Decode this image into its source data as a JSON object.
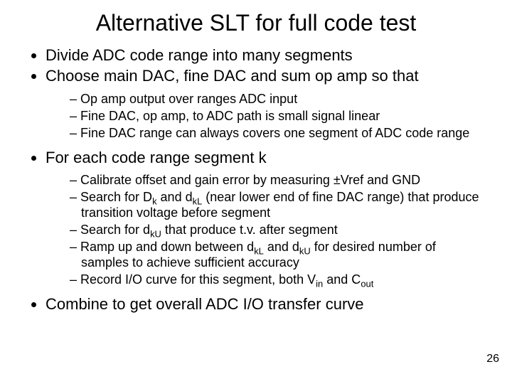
{
  "title": "Alternative SLT for full code test",
  "bullets": {
    "b1": "Divide ADC code range into many segments",
    "b2": "Choose main DAC, fine DAC and sum op amp so that",
    "b2_sub": {
      "s1": "Op amp output over ranges ADC input",
      "s2": "Fine DAC, op amp, to ADC path is small signal linear",
      "s3": "Fine DAC range can always covers one segment of ADC code range"
    },
    "b3": "For each code range segment k",
    "b3_sub": {
      "s1": "Calibrate offset and gain error by measuring ±Vref and GND",
      "s2_a": "Search for D",
      "s2_b": " and d",
      "s2_c": " (near lower end of fine DAC range) that produce transition voltage before segment",
      "s3_a": "Search for d",
      "s3_b": " that produce t.v. after segment",
      "s4_a": "Ramp up and down between d",
      "s4_b": " and d",
      "s4_c": " for desired number of samples to achieve sufficient accuracy",
      "s5_a": "Record I/O curve for this segment, both V",
      "s5_b": " and C"
    },
    "b4": "Combine to get overall ADC I/O transfer curve"
  },
  "subs": {
    "k": "k",
    "kL": "kL",
    "kU": "kU",
    "in": "in",
    "out": "out"
  },
  "page_number": "26"
}
